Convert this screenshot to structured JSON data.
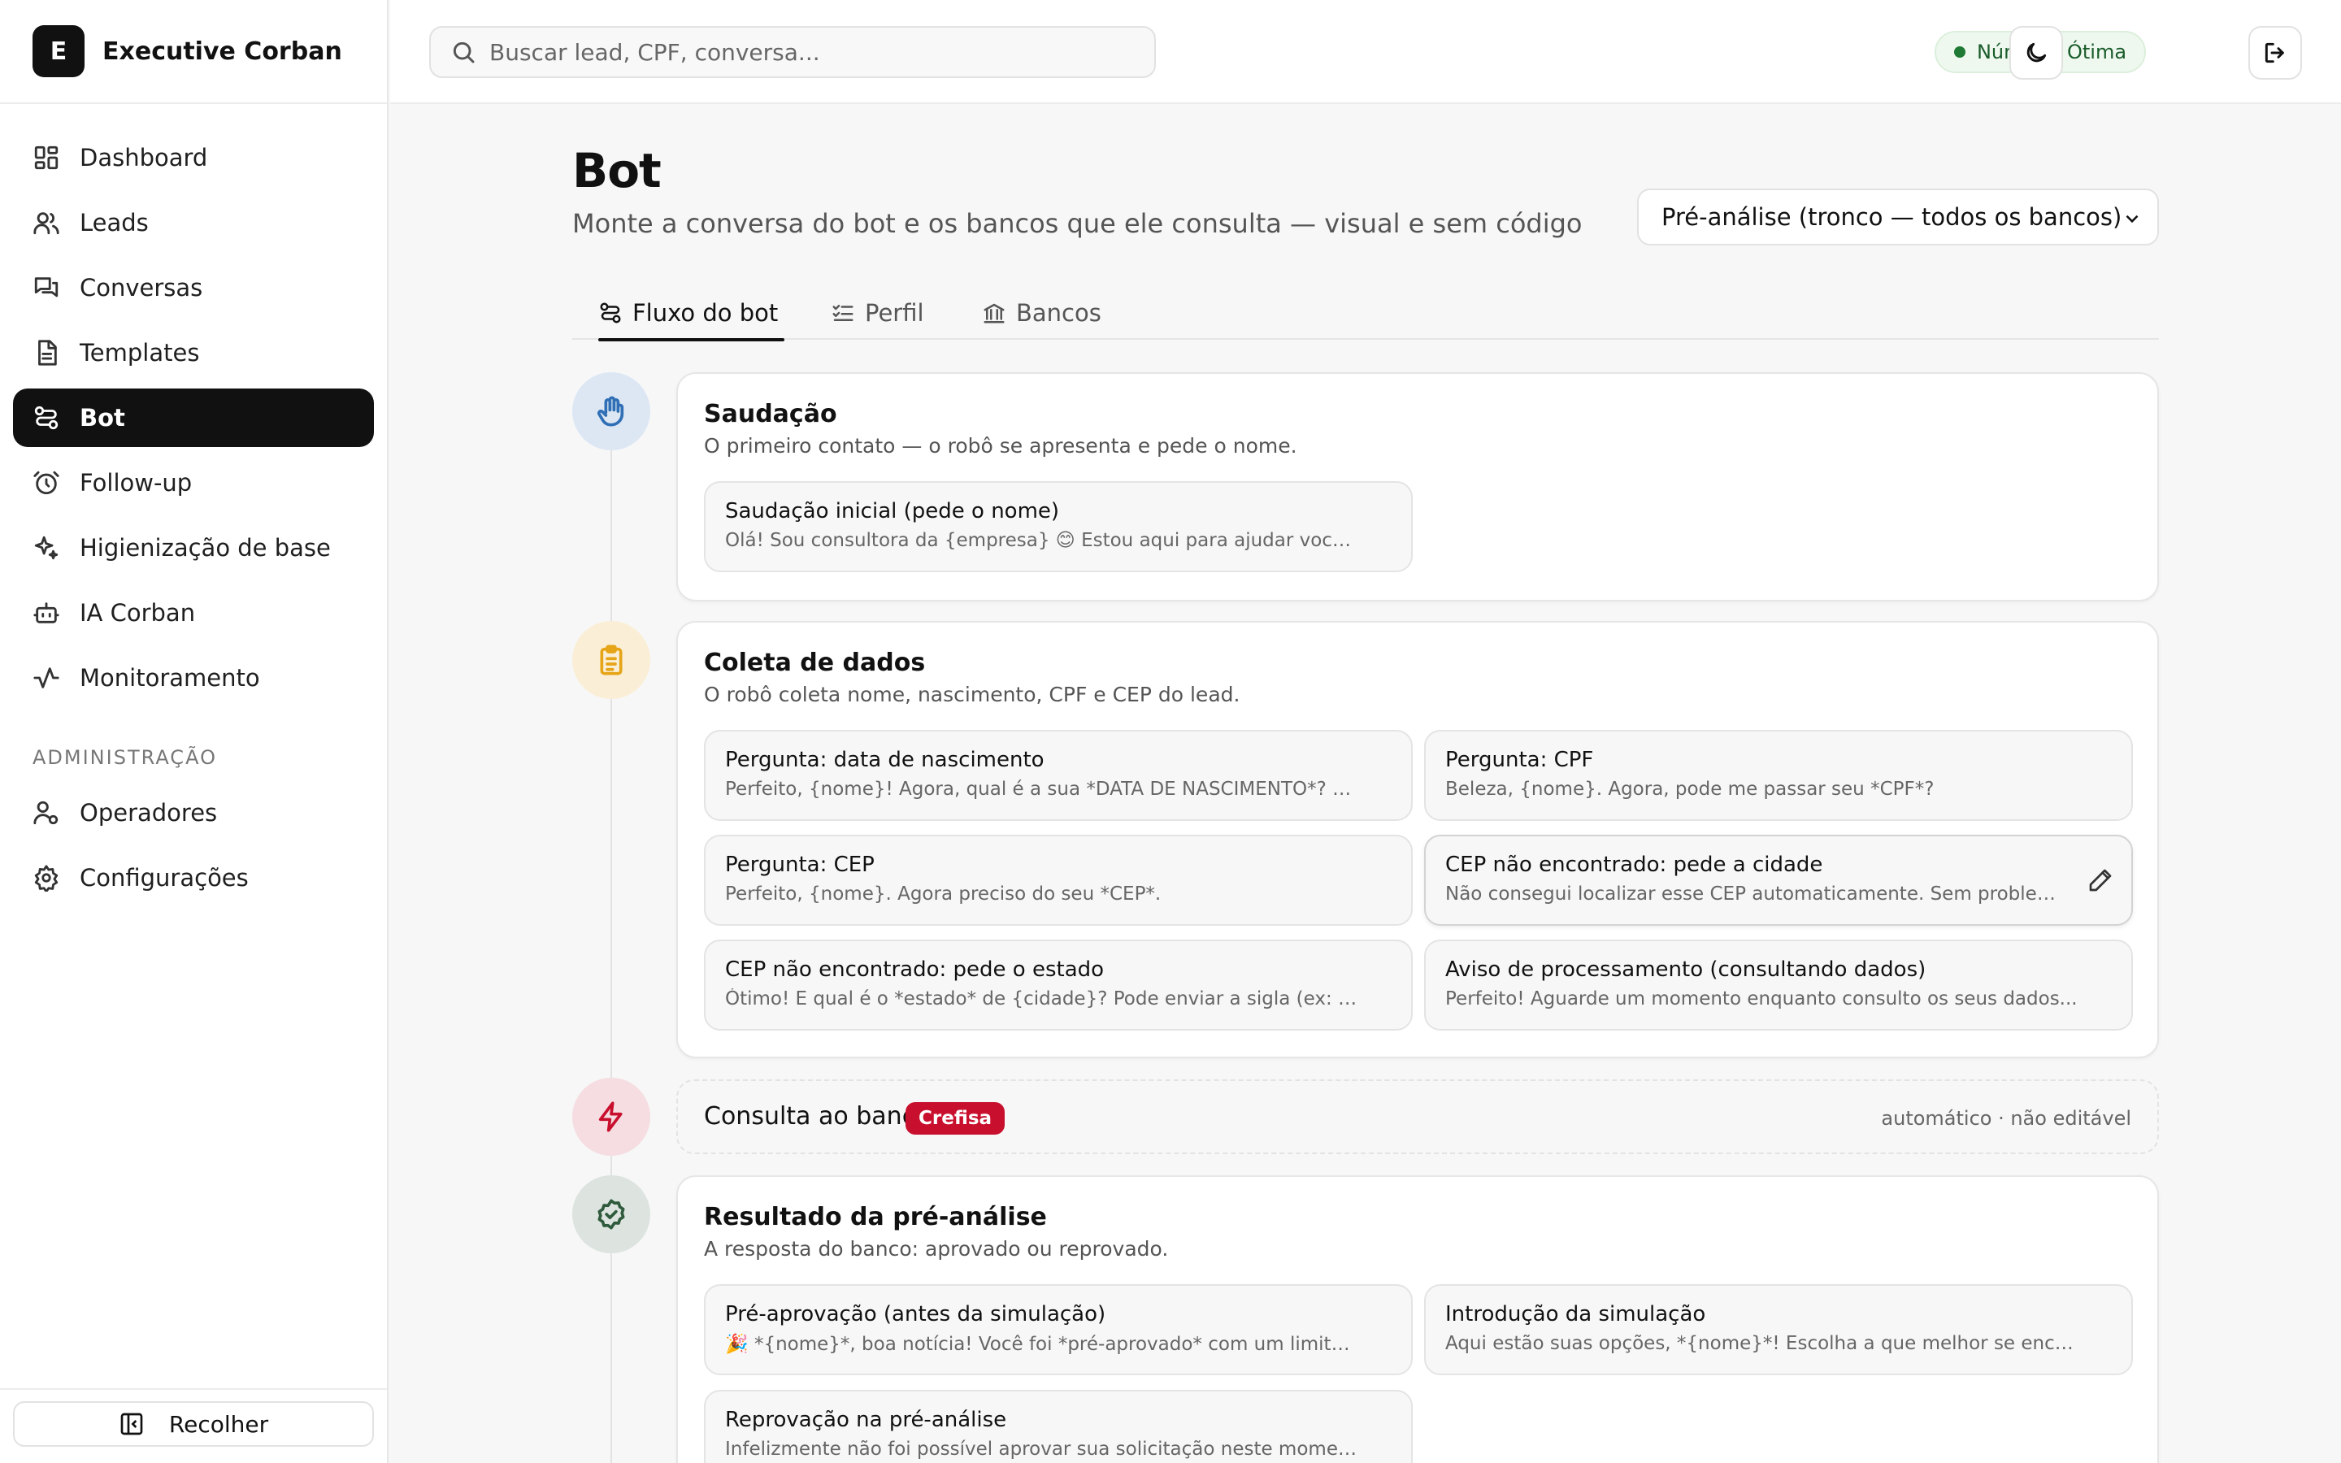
{
  "brand": {
    "logo_letter": "E",
    "name": "Executive Corban"
  },
  "sidebar": {
    "items": [
      {
        "label": "Dashboard",
        "icon": "dashboard-icon"
      },
      {
        "label": "Leads",
        "icon": "users-icon"
      },
      {
        "label": "Conversas",
        "icon": "chat-icon"
      },
      {
        "label": "Templates",
        "icon": "document-icon"
      },
      {
        "label": "Bot",
        "icon": "workflow-icon",
        "active": true
      },
      {
        "label": "Follow-up",
        "icon": "alarm-icon"
      },
      {
        "label": "Higienização de base",
        "icon": "sparkles-icon"
      },
      {
        "label": "IA Corban",
        "icon": "robot-icon"
      },
      {
        "label": "Monitoramento",
        "icon": "activity-icon"
      }
    ],
    "admin_section": "ADMINISTRAÇÃO",
    "admin_items": [
      {
        "label": "Operadores",
        "icon": "user-cog-icon"
      },
      {
        "label": "Configurações",
        "icon": "gear-icon"
      }
    ],
    "collapse_label": "Recolher"
  },
  "topbar": {
    "search_placeholder": "Buscar lead, CPF, conversa...",
    "status_label": "Número: Ótima",
    "status_color": "#1f7a35"
  },
  "page": {
    "title": "Bot",
    "subtitle": "Monte a conversa do bot e os bancos que ele consulta — visual e sem código",
    "flow_selected": "Pré-análise (tronco — todos os bancos)",
    "tabs": [
      {
        "label": "Fluxo do bot",
        "icon": "workflow-icon",
        "active": true
      },
      {
        "label": "Perfil",
        "icon": "checklist-icon"
      },
      {
        "label": "Bancos",
        "icon": "bank-icon"
      }
    ]
  },
  "steps": {
    "greeting": {
      "title": "Saudação",
      "subtitle": "O primeiro contato — o robô se apresenta e pede o nome.",
      "messages": [
        {
          "title": "Saudação inicial (pede o nome)",
          "text": "Olá! Sou consultora da {empresa} 😊 Estou aqui para ajudar você com seu crédito."
        }
      ]
    },
    "collect": {
      "title": "Coleta de dados",
      "subtitle": "O robô coleta nome, nascimento, CPF e CEP do lead.",
      "messages": [
        {
          "title": "Pergunta: data de nascimento",
          "text": "Perfeito, {nome}! Agora, qual é a sua *DATA DE NASCIMENTO*? Envie sem barras."
        },
        {
          "title": "Pergunta: CPF",
          "text": "Beleza, {nome}. Agora, pode me passar seu *CPF*?"
        },
        {
          "title": "Pergunta: CEP",
          "text": "Perfeito, {nome}. Agora preciso do seu *CEP*."
        },
        {
          "title": "CEP não encontrado: pede a cidade",
          "text": "Não consegui localizar esse CEP automaticamente. Sem problemas! Qual a sua cidade?"
        },
        {
          "title": "CEP não encontrado: pede o estado",
          "text": "Ótimo! E qual é o *estado* de {cidade}? Pode enviar a sigla (ex: *SP*, *RJ*)."
        },
        {
          "title": "Aviso de processamento (consultando dados)",
          "text": "Perfeito! Aguarde um momento enquanto consulto os seus dados..."
        }
      ]
    },
    "bank": {
      "title": "Consulta ao banco",
      "badge": "Crefisa",
      "badge_color": "#c8102e",
      "note": "automático · não editável"
    },
    "result": {
      "title": "Resultado da pré-análise",
      "subtitle": "A resposta do banco: aprovado ou reprovado.",
      "messages": [
        {
          "title": "Pré-aprovação (antes da simulação)",
          "text": "🎉 *{nome}*, boa notícia! Você foi *pré-aprovado* com um limite disponível."
        },
        {
          "title": "Introdução da simulação",
          "text": "Aqui estão suas opções, *{nome}*! Escolha a que melhor se encaixa no seu bolso."
        },
        {
          "title": "Reprovação na pré-análise",
          "text": "Infelizmente não foi possível aprovar sua solicitação neste momento."
        }
      ]
    }
  },
  "colors": {
    "greeting_bg": "#dde7f4",
    "greeting_fg": "#2f6fb5",
    "collect_bg": "#faefd6",
    "collect_fg": "#e6a417",
    "bank_bg": "#f6dde1",
    "bank_fg": "#c8102e",
    "result_bg": "#dde4df",
    "result_fg": "#2f5a3c"
  }
}
